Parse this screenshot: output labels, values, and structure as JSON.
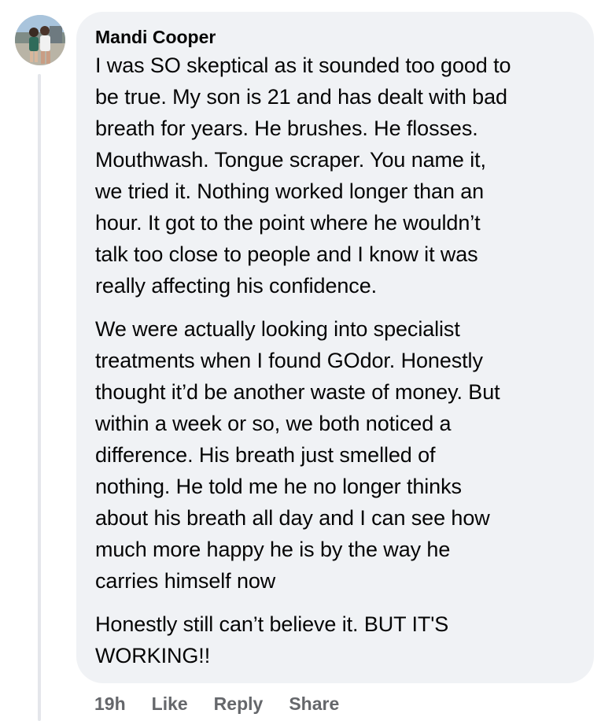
{
  "comment": {
    "author": "Mandi Cooper",
    "paragraphs": [
      "I was SO skeptical as it sounded too good to\nbe true. My son is 21 and has dealt with bad\nbreath for years. He brushes. He flosses.\nMouthwash. Tongue scraper. You name it,\nwe tried it. Nothing worked longer than an\nhour. It got to the point where he wouldn’t\ntalk too close to people and I know it was\nreally affecting his confidence.",
      "We were actually looking into specialist\ntreatments when I found GOdor. Honestly\nthought it’d be another waste of money. But\nwithin a week or so, we both noticed a\ndifference. His breath just smelled of\nnothing. He told me he no longer thinks\nabout his breath all day and I can see how\nmuch more happy he is by the way he\ncarries himself now",
      "Honestly still can’t believe it. BUT IT'S\nWORKING!!"
    ],
    "actions": {
      "time": "19h",
      "like": "Like",
      "reply": "Reply",
      "share": "Share"
    }
  },
  "colors": {
    "bubble": "#f0f2f5",
    "text": "#050505",
    "secondary_text": "#65676b",
    "thread_line": "#e4e6eb"
  },
  "icons": {
    "avatar": "profile-photo"
  }
}
